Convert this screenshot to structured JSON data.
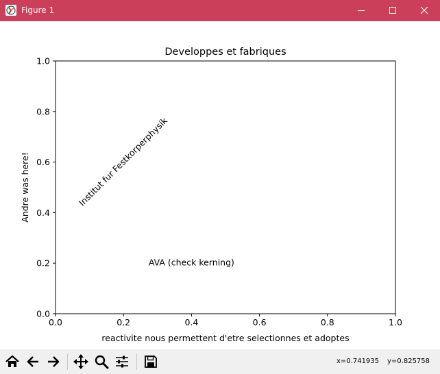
{
  "window": {
    "title": "Figure 1",
    "icon": "matplotlib-figure-icon",
    "controls": [
      "minimize-icon",
      "maximize-icon",
      "close-icon"
    ],
    "titlebar_color": "#cc3f5b"
  },
  "chart_data": {
    "type": "scatter",
    "title": "Developpes et fabriques",
    "xlabel": "reactivite nous permettent d'etre selectionnes et adoptes",
    "ylabel": "Andre was here!",
    "xlim": [
      0.0,
      1.0
    ],
    "ylim": [
      0.0,
      1.0
    ],
    "xticks": [
      "0.0",
      "0.2",
      "0.4",
      "0.6",
      "0.8",
      "1.0"
    ],
    "yticks": [
      "0.0",
      "0.2",
      "0.4",
      "0.6",
      "0.8",
      "1.0"
    ],
    "grid": false,
    "series": [],
    "annotations": [
      {
        "text": "Institut fur Festkorperphysik",
        "x": 0.2,
        "y": 0.6,
        "rotation": 45
      },
      {
        "text": "AVA (check kerning)",
        "x": 0.4,
        "y": 0.2,
        "rotation": 0
      }
    ]
  },
  "toolbar": {
    "tools": [
      {
        "name": "home-icon"
      },
      {
        "name": "back-arrow-icon"
      },
      {
        "name": "forward-arrow-icon"
      },
      {
        "name": "pan-move-icon"
      },
      {
        "name": "zoom-magnifier-icon"
      },
      {
        "name": "configure-subplots-icon"
      },
      {
        "name": "save-floppy-icon"
      }
    ],
    "cursor_x": "x=0.741935",
    "cursor_y": "y=0.825758"
  }
}
